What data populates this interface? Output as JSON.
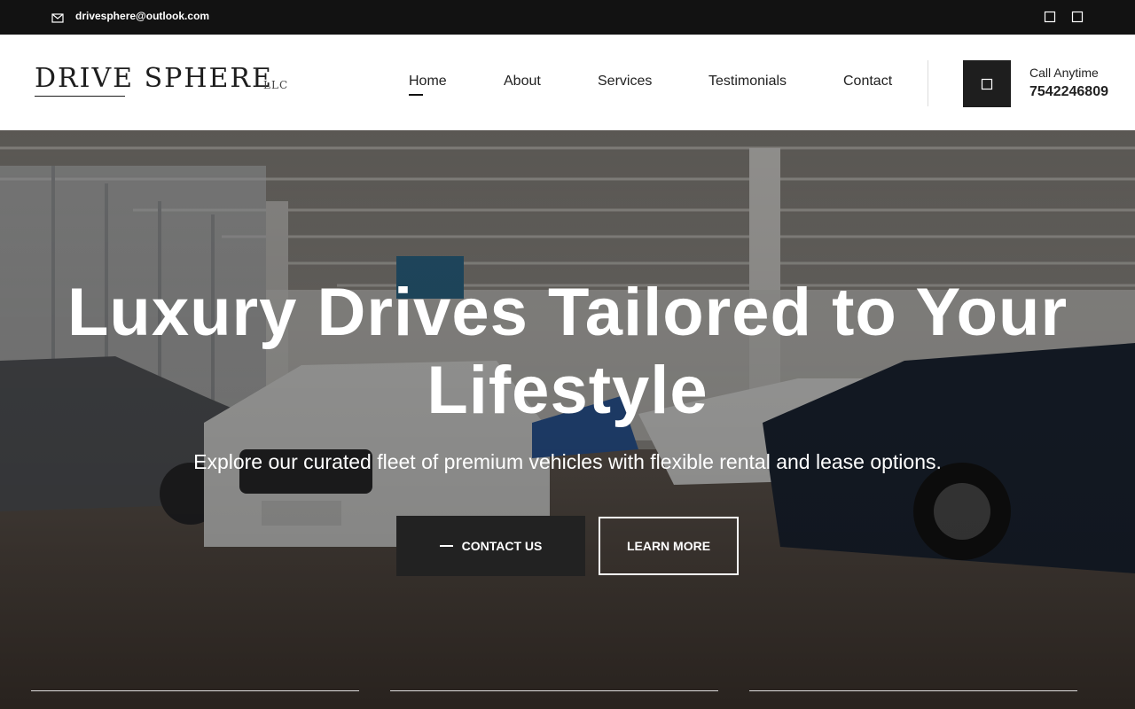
{
  "topbar": {
    "email": "drivesphere@outlook.com",
    "icons": [
      "envelope-icon",
      "facebook-icon",
      "instagram-icon"
    ]
  },
  "header": {
    "logo_main": "DRIVE SPHERE",
    "logo_suffix": "LLC",
    "nav": [
      {
        "label": "Home",
        "active": true
      },
      {
        "label": "About",
        "active": false
      },
      {
        "label": "Services",
        "active": false
      },
      {
        "label": "Testimonials",
        "active": false
      },
      {
        "label": "Contact",
        "active": false
      }
    ],
    "call_label": "Call Anytime",
    "call_number": "7542246809",
    "phone_icon": "phone-icon"
  },
  "hero": {
    "title": "Luxury Drives Tailored to Your Lifestyle",
    "subtitle": "Explore our curated fleet of premium vehicles with flexible rental and lease options.",
    "primary_button": "CONTACT US",
    "secondary_button": "LEARN MORE",
    "background": "car-showroom-photo"
  },
  "colors": {
    "topbar_bg": "#121212",
    "header_bg": "#ffffff",
    "dark_button": "#222222",
    "text_dark": "#222222",
    "hero_text": "#ffffff"
  }
}
